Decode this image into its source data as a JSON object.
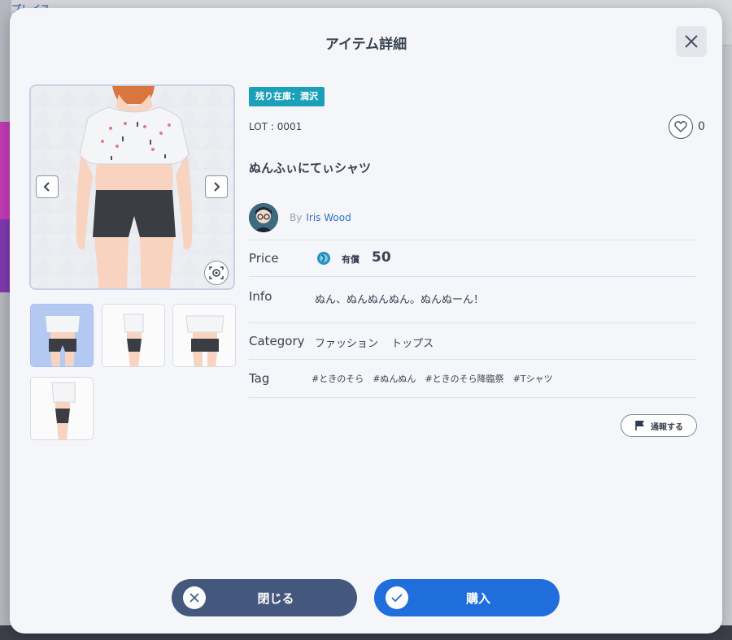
{
  "background": {
    "top_label": "プレイス"
  },
  "modal": {
    "title": "アイテム詳細"
  },
  "item": {
    "stock_badge": "残り在庫：潤沢",
    "lot": "LOT : 0001",
    "like_count": "0",
    "name": "ぬんふぃにてぃシャツ",
    "creator": {
      "by": "By",
      "name": "Iris Wood"
    },
    "price": {
      "label": "Price",
      "type": "有償",
      "value": "50"
    },
    "info": {
      "label": "Info",
      "text": "ぬん、ぬんぬんぬん。ぬんぬーん！"
    },
    "category": {
      "label": "Category",
      "values": [
        "ファッション",
        "トップス"
      ]
    },
    "tag": {
      "label": "Tag",
      "values": [
        "#ときのそら",
        "#ぬんぬん",
        "#ときのそら降臨祭",
        "#Tシャツ"
      ]
    }
  },
  "report_button": {
    "label": "通報する"
  },
  "footer": {
    "close_label": "閉じる",
    "buy_label": "購入"
  },
  "colors": {
    "badge": "#1aa0b8",
    "close_button": "#44587d",
    "buy_button": "#1f6edc",
    "link": "#2f6fc9"
  },
  "icons": {
    "close": "close-icon",
    "like": "heart-icon",
    "prev": "chevron-left-icon",
    "next": "chevron-right-icon",
    "ar": "ar-view-icon",
    "report": "flag-icon",
    "coin": "coin-icon"
  }
}
